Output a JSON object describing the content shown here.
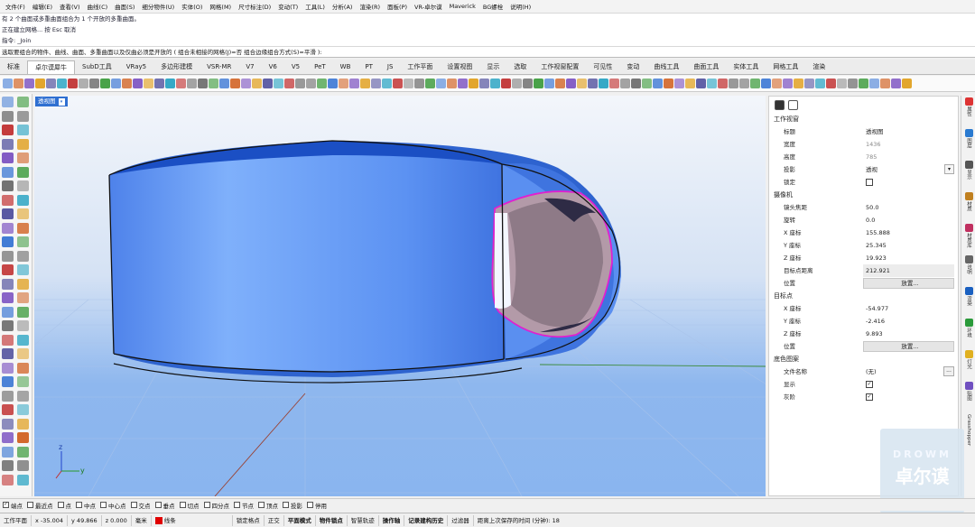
{
  "menu": [
    "文件(F)",
    "编辑(E)",
    "查看(V)",
    "曲线(C)",
    "曲面(S)",
    "细分物件(U)",
    "实体(O)",
    "网格(M)",
    "尺寸标注(D)",
    "变动(T)",
    "工具(L)",
    "分析(A)",
    "渲染(R)",
    "面板(P)",
    "VR-卓尔谟",
    "Maverick",
    "BG螺栓",
    "说明(H)"
  ],
  "history": [
    "有 2 个曲面或多重曲面组合为 1 个开放的多重曲面。",
    "正在建立网格... 按 Esc 取消",
    "指令: _Join"
  ],
  "prompt": "选取要组合的物件、曲线、曲面、多重曲面以及仅曲必须是开放的 ( 组合未相接的网格(J)=否  组合边缘组合方式(S)=平滑 ):",
  "tabs": [
    "标准",
    "卓尔谟犀牛",
    "SubD工具",
    "VRay5",
    "多边形建模",
    "VSR-MR",
    "V7",
    "V6",
    "V5",
    "PeT",
    "WB",
    "PT",
    "JS",
    "工作平面",
    "设置视图",
    "显示",
    "选取",
    "工作视窗配置",
    "可见性",
    "变动",
    "曲线工具",
    "曲面工具",
    "实体工具",
    "网格工具",
    "渲染"
  ],
  "active_tab": "卓尔谟犀牛",
  "viewport": {
    "label": "透视图",
    "dropdown": "▾"
  },
  "axes": {
    "x": "x",
    "y": "y",
    "z": "z"
  },
  "panel": {
    "section_view": "工作视窗",
    "view_rows": [
      {
        "k": "标题",
        "v": "透视图"
      },
      {
        "k": "宽度",
        "v": "1436"
      },
      {
        "k": "高度",
        "v": "785"
      },
      {
        "k": "投影",
        "v": "透视"
      },
      {
        "k": "锁定",
        "v": ""
      }
    ],
    "section_camera": "摄像机",
    "camera_rows": [
      {
        "k": "镜头焦距",
        "v": "50.0"
      },
      {
        "k": "旋转",
        "v": "0.0"
      },
      {
        "k": "X 座标",
        "v": "155.888"
      },
      {
        "k": "Y 座标",
        "v": "25.345"
      },
      {
        "k": "Z 座标",
        "v": "19.923"
      },
      {
        "k": "目标点距离",
        "v": "212.921"
      },
      {
        "k": "位置",
        "v": "放置..."
      }
    ],
    "section_target": "目标点",
    "target_rows": [
      {
        "k": "X 座标",
        "v": "-54.977"
      },
      {
        "k": "Y 座标",
        "v": "-2.416"
      },
      {
        "k": "Z 座标",
        "v": "9.893"
      },
      {
        "k": "位置",
        "v": "放置..."
      }
    ],
    "section_wall": "底色图案",
    "wall_rows": [
      {
        "k": "文件名称",
        "v": "(无)"
      },
      {
        "k": "显示",
        "v": "✓"
      },
      {
        "k": "灰阶",
        "v": "✓"
      }
    ],
    "dots": "..."
  },
  "right_tabs": [
    "属性",
    "图层",
    "显示",
    "材质",
    "材质库",
    "说明",
    "渲染",
    "环境",
    "灯光",
    "贴图",
    "Grasshopper"
  ],
  "watermark": {
    "top": "DROWM",
    "bottom": "卓尔谟"
  },
  "osnaps": [
    {
      "l": "端点",
      "on": true
    },
    {
      "l": "最近点",
      "on": false
    },
    {
      "l": "点",
      "on": false
    },
    {
      "l": "中点",
      "on": false
    },
    {
      "l": "中心点",
      "on": false
    },
    {
      "l": "交点",
      "on": false
    },
    {
      "l": "垂点",
      "on": false
    },
    {
      "l": "切点",
      "on": false
    },
    {
      "l": "四分点",
      "on": false
    },
    {
      "l": "节点",
      "on": false
    },
    {
      "l": "顶点",
      "on": false
    },
    {
      "l": "投影",
      "on": false
    },
    {
      "l": "停用",
      "on": false
    }
  ],
  "status": {
    "cplane": "工作平面",
    "x": "x -35.004",
    "y": "y 49.866",
    "z": "z 0.000",
    "unit": "毫米",
    "layer": "线条",
    "toggles": [
      "锁定格点",
      "正交",
      "平面模式",
      "物件锁点",
      "智慧轨迹",
      "操作轴",
      "记录建构历史",
      "过滤器"
    ],
    "save": "距离上次保存的时间 (分钟): 18"
  },
  "colors": {
    "accent": "#2f6fd1",
    "object": "#5b8ff0",
    "selection": "#e020d0",
    "viewport_bottom": "#8ab5ef"
  }
}
